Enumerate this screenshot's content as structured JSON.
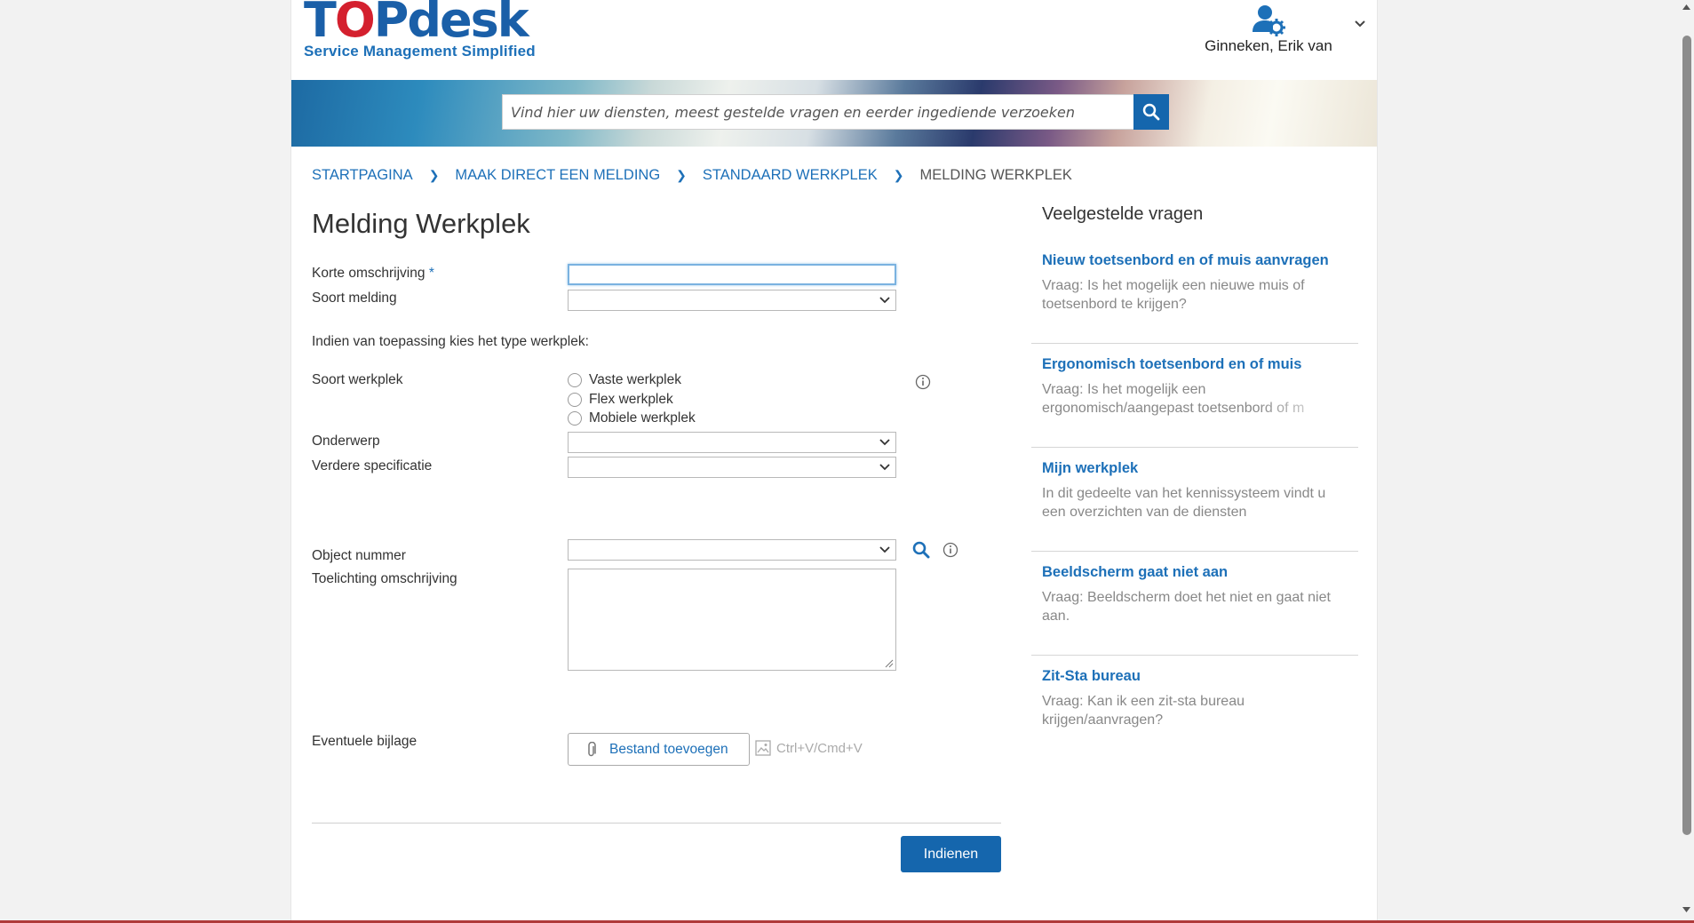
{
  "header": {
    "logo_main_pre": "T",
    "logo_main_o": "O",
    "logo_main_post": "Pdesk",
    "logo_subtitle": "Service Management Simplified",
    "user_name": "Ginneken, Erik van"
  },
  "search": {
    "placeholder": "Vind hier uw diensten, meest gestelde vragen en eerder ingediende verzoeken"
  },
  "breadcrumb": [
    "STARTPAGINA",
    "MAAK DIRECT EEN MELDING",
    "STANDAARD WERKPLEK",
    "MELDING WERKPLEK"
  ],
  "form": {
    "title": "Melding Werkplek",
    "korte_omschrijving_label": "Korte omschrijving",
    "required_marker": "*",
    "korte_omschrijving_value": "",
    "soort_melding_label": "Soort melding",
    "soort_melding_value": "",
    "type_werkplek_hint": "Indien van toepassing kies het type werkplek:",
    "soort_werkplek_label": "Soort werkplek",
    "radio_options": [
      "Vaste werkplek",
      "Flex werkplek",
      "Mobiele werkplek"
    ],
    "onderwerp_label": "Onderwerp",
    "onderwerp_value": "",
    "verdere_specificatie_label": "Verdere specificatie",
    "verdere_specificatie_value": "",
    "object_nummer_label": "Object nummer",
    "object_nummer_value": "",
    "toelichting_label": "Toelichting omschrijving",
    "toelichting_value": "",
    "bijlage_label": "Eventuele bijlage",
    "attach_button": "Bestand toevoegen",
    "paste_hint": "Ctrl+V/Cmd+V",
    "submit_button": "Indienen"
  },
  "faq": {
    "title": "Veelgestelde vragen",
    "items": [
      {
        "question": "Nieuw toetsenbord en of muis aanvragen",
        "answer": "Vraag: Is het mogelijk een nieuwe muis of toetsenbord te krijgen?"
      },
      {
        "question": "Ergonomisch toetsenbord en of muis",
        "answer": "Vraag: Is het mogelijk een ergonomisch/aangepast toetsenbord of m"
      },
      {
        "question": "Mijn werkplek",
        "answer": "In dit gedeelte van het kennissysteem vindt u een overzichten van de diensten"
      },
      {
        "question": "Beeldscherm gaat niet aan",
        "answer": "Vraag: Beeldscherm doet het niet en gaat niet aan."
      },
      {
        "question": "Zit-Sta bureau",
        "answer": "Vraag: Kan ik een zit-sta bureau krijgen/aanvragen?"
      }
    ]
  },
  "colors": {
    "brand_blue": "#1566ad",
    "link_blue": "#1d70b8",
    "logo_red": "#d4202e"
  },
  "icons": [
    "user-settings-icon",
    "chevron-down-icon",
    "search-icon",
    "info-icon",
    "paperclip-icon",
    "image-icon",
    "resize-grip-icon"
  ]
}
